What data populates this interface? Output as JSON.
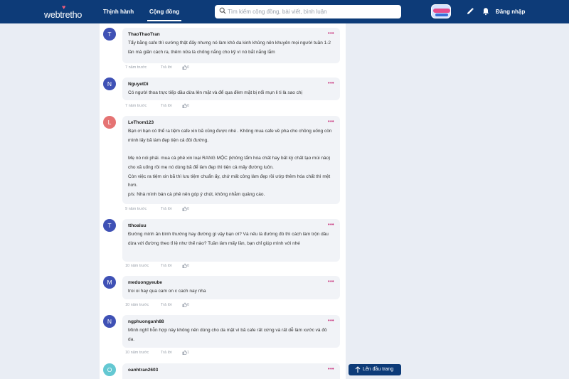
{
  "header": {
    "logo_text": "webtretho",
    "tabs": [
      {
        "label": "Thịnh hành"
      },
      {
        "label": "Cộng đồng"
      }
    ],
    "search_placeholder": "Tìm kiếm cộng đồng, bài viết, bình luận",
    "login_label": "Đăng nhập"
  },
  "colors": {
    "header_bg": "#0d3b78",
    "more_dots": "#c2186b",
    "avatar_blue": "#3f51b5",
    "avatar_red": "#e57373",
    "avatar_teal": "#64c8d2"
  },
  "comments": [
    {
      "initial": "T",
      "author": "ThaoThaoTran",
      "more": "•••",
      "text": "Tẩy bằng cafe thì sướng thật đấy nhưng nó làm khô da kinh khủng nên khuyên mọi người tuần 1-2 lần mà giãn cách ra, thêm nữa là chống nắng cho kỹ vì nó bắt nắng lắm",
      "time": "7 năm trước",
      "reply": "Trả lời",
      "likes": "0"
    },
    {
      "initial": "N",
      "author": "NguyetDi",
      "more": "•••",
      "text": "Có người thoa trực tiếp dầu dừa lên mặt và để qua đêm mặt bị nổi mụn li ti là sao chị",
      "time": "7 năm trước",
      "reply": "Trả lời",
      "likes": "0"
    },
    {
      "initial": "L",
      "author": "LeThom123",
      "more": "•••",
      "text": "Bạn ơi bạn có thể ra tiệm cafe xin bã cũng được nhé . Không mua cafe về pha cho chồng uống còn mình lấy bã làm đẹp tiện cả đôi đường.\n\nMẹ nó nói phải. mua cà phê xin loại RANG MỘC (không tẩm hóa chất hay bất kỳ chất tạo mùi nào) cho xã uống rồi mẹ nó dùng bã để làm đẹp thì tiện cả mấy đường luôn.\nCòn việc ra tiệm xin bã thì lưu tiệm chuẩn ấy, chứ mất công làm đẹp rồi ướp thêm hóa chất thì mệt hơn.\np/s: Nhà mình bán cà phê nên góp ý chút, không nhằm quảng cáo.",
      "time": "9 năm trước",
      "reply": "Trả lời",
      "likes": "0"
    },
    {
      "initial": "T",
      "author": "tthoaluu",
      "more": "•••",
      "text": "Đường mình ăn bình thường hay đường gì vậy bạn ơi? Và nếu là đường đó thì cách làm trộn dầu dừa với đường theo tỉ lệ như thế nào? Tuần làm mấy lần, bạn chỉ giúp mình với nhé",
      "time": "10 năm trước",
      "reply": "Trả lời",
      "likes": "0"
    },
    {
      "initial": "M",
      "author": "meduongyeube",
      "more": "•••",
      "text": "troi oi hay qua cam on c cach nay nha",
      "time": "10 năm trước",
      "reply": "Trả lời",
      "likes": "0"
    },
    {
      "initial": "N",
      "author": "ngphuonganh88",
      "more": "•••",
      "text": "Mình nghĩ hỗn hợp này không nên dùng cho da mặt vì bã cafe rất cứng và rất dễ làm xước và đỏ da.",
      "time": "10 năm trước",
      "reply": "Trả lời",
      "likes": "1"
    },
    {
      "initial": "O",
      "author": "oanhtran2603",
      "more": "•••",
      "text": "",
      "time": "",
      "reply": "",
      "likes": ""
    }
  ],
  "back_to_top_label": "Lên đầu trang"
}
